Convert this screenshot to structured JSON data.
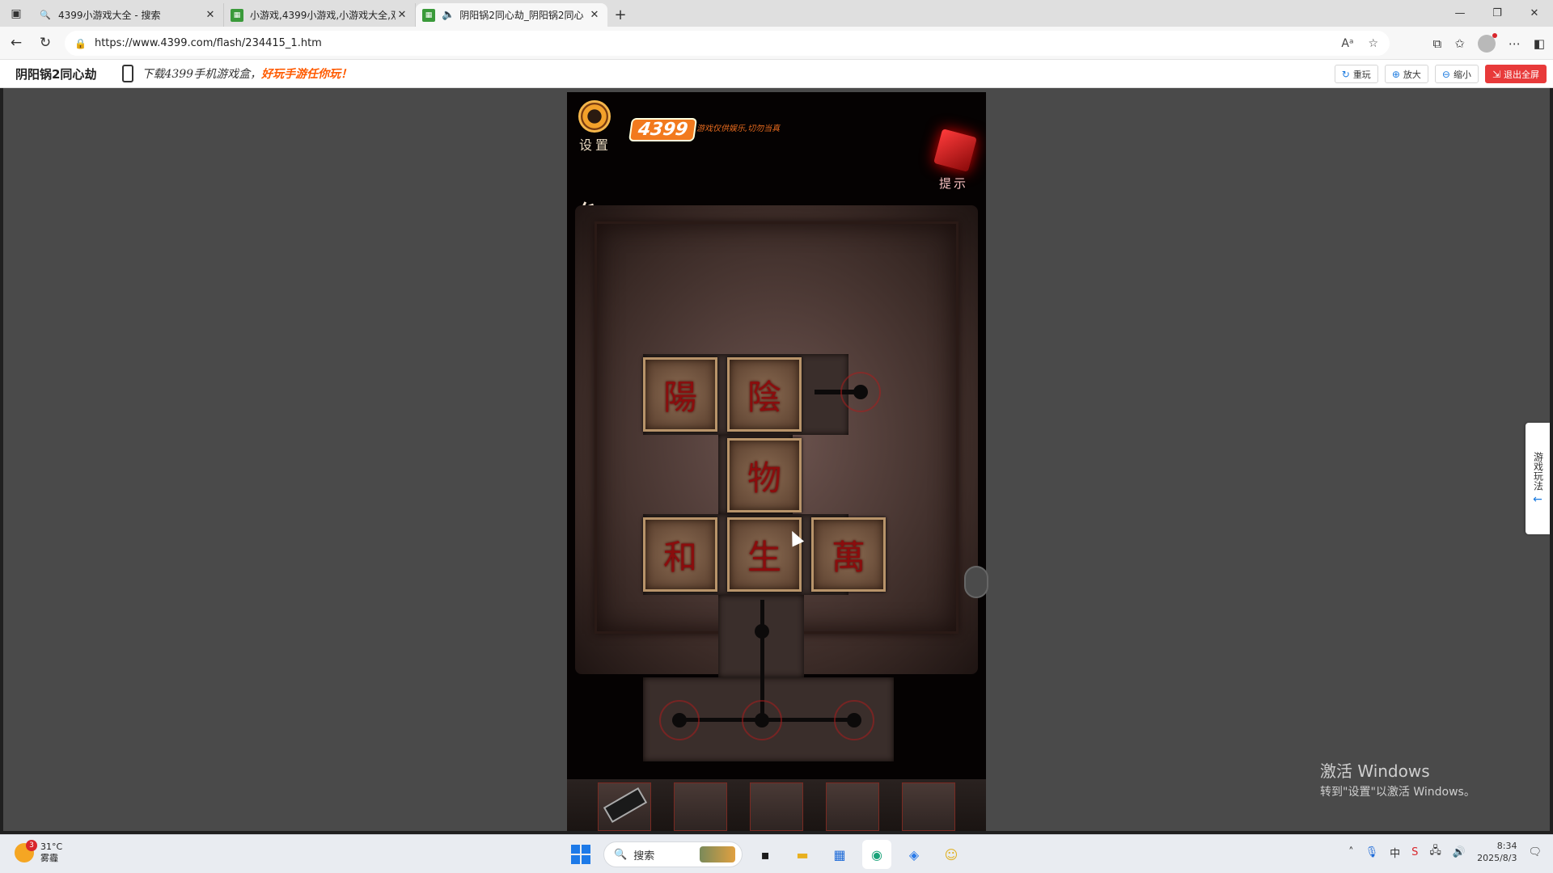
{
  "browser": {
    "tabs": [
      {
        "title": "4399小游戏大全 - 搜索",
        "icon": "search-icon",
        "active": false
      },
      {
        "title": "小游戏,4399小游戏,小游戏大全,双",
        "icon": "4399-favicon",
        "active": false
      },
      {
        "title": "阴阳锅2同心劫_阴阳锅2同心",
        "icon": "4399-favicon",
        "active": true
      }
    ],
    "new_tab": "+",
    "url": "https://www.4399.com/flash/234415_1.htm"
  },
  "site": {
    "game_name": "阴阳锅2同心劫",
    "promo_text": "下载4399手机游戏盒，",
    "promo_highlight": "好玩手游任你玩！",
    "buttons": {
      "replay": "重玩",
      "zoom_in": "放大",
      "zoom_out": "缩小",
      "exit_fullscreen": "退出全屏"
    },
    "side_tab": "游戏玩法",
    "side_tab_arrow": "←"
  },
  "game": {
    "settings_label": "设置",
    "logo": "4399",
    "disclaimer": "游戏仅供娱乐,切勿当真",
    "hint_label": "提示",
    "tiles": [
      "陽",
      "陰",
      "物",
      "和",
      "生",
      "萬"
    ],
    "inventory_slots": 5,
    "accent_red": "#c8141a"
  },
  "watermark": {
    "line1": "激活 Windows",
    "line2": "转到\"设置\"以激活 Windows。"
  },
  "taskbar": {
    "temperature": "31°C",
    "weather": "雾霾",
    "weather_badge": "3",
    "search_placeholder": "搜索",
    "ime": "中",
    "time": "8:34",
    "date": "2025/8/3"
  }
}
